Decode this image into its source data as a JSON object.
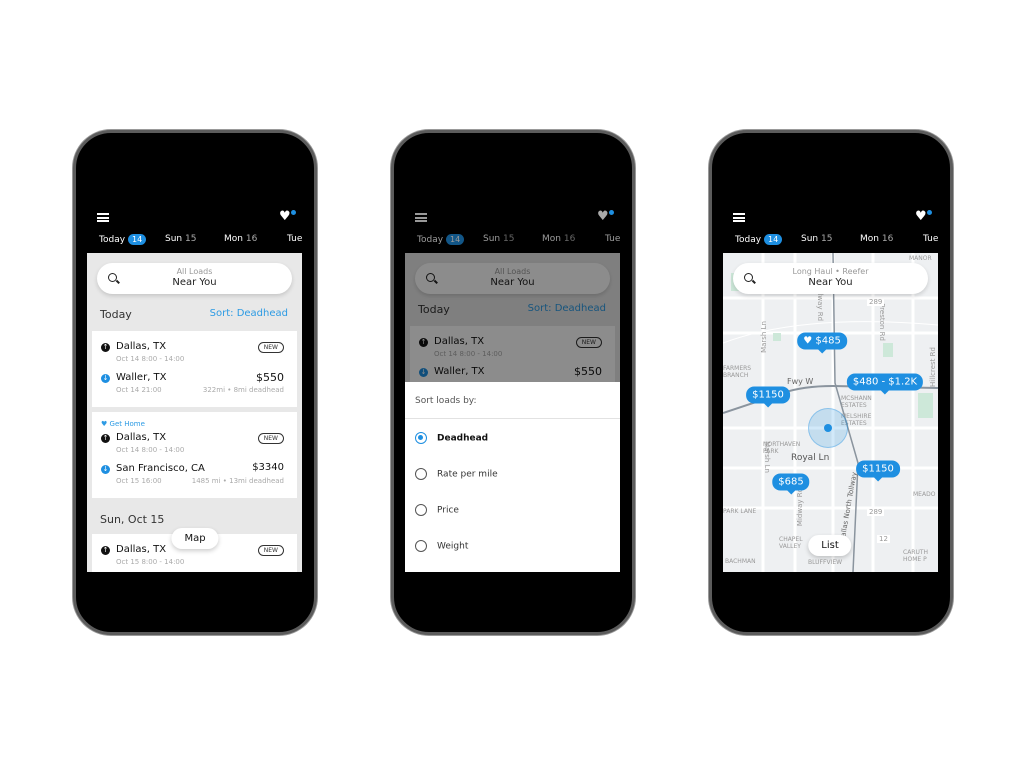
{
  "header": {
    "tabs": [
      {
        "label": "Today",
        "badge": "14"
      },
      {
        "label": "Sun",
        "num": "15"
      },
      {
        "label": "Mon",
        "num": "16"
      },
      {
        "label": "Tue"
      }
    ]
  },
  "list_screen": {
    "search": {
      "filter": "All Loads",
      "location": "Near You"
    },
    "section_today": "Today",
    "sort_label": "Sort: Deadhead",
    "loads": [
      {
        "origin": "Dallas, TX",
        "origin_time": "Oct 14 8:00 - 14:00",
        "dest": "Waller, TX",
        "dest_time": "Oct 14 21:00",
        "price": "$550",
        "distance": "322mi • 8mi deadhead",
        "badge": "NEW"
      },
      {
        "tag": "Get Home",
        "origin": "Dallas, TX",
        "origin_time": "Oct 14 8:00 - 14:00",
        "dest": "San Francisco, CA",
        "dest_time": "Oct 15 16:00",
        "price": "$3340",
        "distance": "1485 mi • 13mi deadhead",
        "badge": "NEW"
      },
      {
        "origin": "Dallas, TX",
        "origin_time": "Oct 15 8:00 - 14:00",
        "badge": "NEW"
      }
    ],
    "section_sun": "Sun, Oct 15",
    "map_button": "Map"
  },
  "sort_screen": {
    "sheet_title": "Sort loads by:",
    "options": [
      {
        "label": "Deadhead",
        "selected": true
      },
      {
        "label": "Rate per mile",
        "selected": false
      },
      {
        "label": "Price",
        "selected": false
      },
      {
        "label": "Weight",
        "selected": false
      }
    ]
  },
  "map_screen": {
    "search": {
      "filter": "Long Haul • Reefer",
      "location": "Near You"
    },
    "price_tags": [
      {
        "label": "$485",
        "favorite": true
      },
      {
        "label": "$480 - $1.2K"
      },
      {
        "label": "$1150"
      },
      {
        "label": "$1150"
      },
      {
        "label": "$685"
      }
    ],
    "map_labels": [
      "Midway Rd",
      "Marsh Ln",
      "Preston Rd",
      "Hillcrest Rd",
      "Fwy W",
      "MCSHANN ESTATES",
      "MELSHIRE ESTATES",
      "NORTHAVEN PARK",
      "Royal Ln",
      "Marsh Ln",
      "Dallas North Tollway",
      "Midway Rd",
      "289",
      "289",
      "12",
      "MEADO",
      "CARUTH HOME P",
      "CHAPEL VALLEY",
      "BLUFFVIEW",
      "BACHMAN",
      "MANOR",
      "FARMERS BRANCH",
      "PARK LANE"
    ],
    "list_button": "List"
  },
  "colors": {
    "accent": "#1e8fe1",
    "header": "#000000",
    "background": "#e8e8e8"
  }
}
